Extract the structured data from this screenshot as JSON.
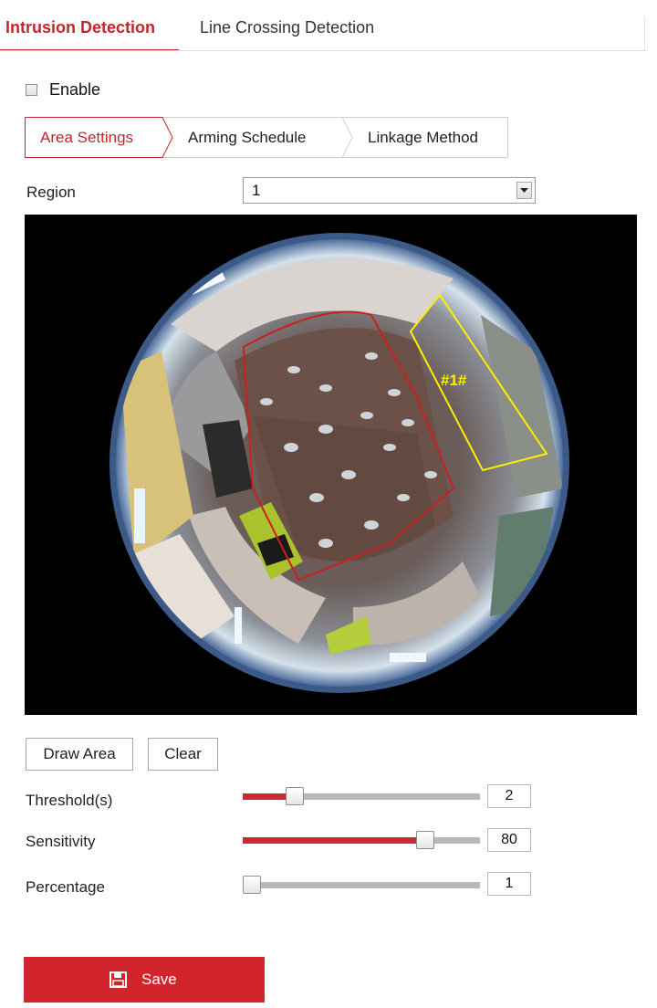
{
  "tabs": [
    {
      "label": "Intrusion Detection",
      "active": true
    },
    {
      "label": "Line Crossing Detection",
      "active": false
    }
  ],
  "enable": {
    "label": "Enable",
    "checked": false
  },
  "sub_tabs": [
    {
      "label": "Area Settings",
      "active": true
    },
    {
      "label": "Arming Schedule",
      "active": false
    },
    {
      "label": "Linkage Method",
      "active": false
    }
  ],
  "region": {
    "label": "Region",
    "value": "1"
  },
  "video": {
    "region_tag": "#1#",
    "region_color": "#ffee00",
    "rope_color": "#cc1f1f"
  },
  "buttons": {
    "draw_area": "Draw Area",
    "clear": "Clear"
  },
  "sliders": [
    {
      "label": "Threshold(s)",
      "value": "2",
      "fraction": 0.22
    },
    {
      "label": "Sensitivity",
      "value": "80",
      "fraction": 0.77
    },
    {
      "label": "Percentage",
      "value": "1",
      "fraction": 0.04
    }
  ],
  "save": {
    "label": "Save",
    "icon": "floppy-disk-icon"
  },
  "colors": {
    "accent": "#c4262b",
    "save_bg": "#d1242b",
    "track": "#b9b9b9"
  }
}
